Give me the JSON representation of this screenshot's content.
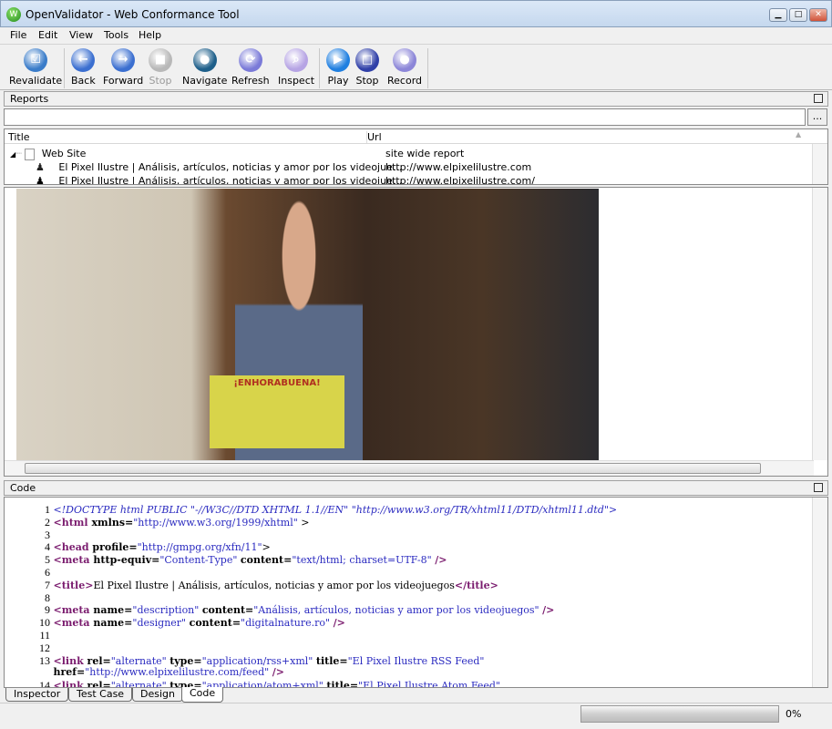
{
  "window": {
    "title": "OpenValidator - Web Conformance Tool",
    "icon": "app-logo-icon",
    "minimize": "minimize-icon",
    "maximize": "maximize-icon",
    "close": "close-icon"
  },
  "menu": [
    "File",
    "Edit",
    "View",
    "Tools",
    "Help"
  ],
  "toolbar": [
    {
      "label": "Revalidate",
      "icon": "check-icon",
      "glyph": "☑",
      "color": "#3a7cc9",
      "enabled": true
    },
    {
      "label": "Back",
      "icon": "back-arrow-icon",
      "glyph": "←",
      "color": "#3b6fd0",
      "enabled": true
    },
    {
      "label": "Forward",
      "icon": "forward-arrow-icon",
      "glyph": "→",
      "color": "#3b6fd0",
      "enabled": true
    },
    {
      "label": "Stop",
      "icon": "stop-icon",
      "glyph": "■",
      "color": "#b8b8b8",
      "enabled": false
    },
    {
      "label": "Navigate",
      "icon": "globe-icon",
      "glyph": "●",
      "color": "#1e5f8a",
      "enabled": true
    },
    {
      "label": "Refresh",
      "icon": "refresh-icon",
      "glyph": "⟳",
      "color": "#7a7ad8",
      "enabled": true
    },
    {
      "label": "Inspect",
      "icon": "magnifier-icon",
      "glyph": "⌕",
      "color": "#b6a4e4",
      "enabled": true
    },
    {
      "label": "Play",
      "icon": "play-icon",
      "glyph": "▶",
      "color": "#1f7fe0",
      "enabled": true
    },
    {
      "label": "Stop",
      "icon": "stop-square-icon",
      "glyph": "□",
      "color": "#3040a8",
      "enabled": true
    },
    {
      "label": "Record",
      "icon": "record-icon",
      "glyph": "●",
      "color": "#8c86d8",
      "enabled": true
    }
  ],
  "reports": {
    "header": "Reports",
    "filter_value": "",
    "browse_label": "...",
    "columns": [
      "Title",
      "Url"
    ],
    "rows": [
      {
        "title": "Web Site",
        "url": "site wide report",
        "icon": "page-icon"
      },
      {
        "title": "El Pixel Ilustre | Análisis, artículos, noticias y amor por los videojue...",
        "url": "http://www.elpixelilustre.com",
        "icon": "inspector-figure-icon"
      },
      {
        "title": "El Pixel Ilustre | Análisis, artículos, noticias y amor por los videojue...",
        "url": "http://www.elpixelilustre.com/",
        "icon": "inspector-figure-icon"
      }
    ]
  },
  "browser": {
    "image": "photo of a young man holding a yellow ¡ENHORABUENA! card in front of bookshelves",
    "card_text": "¡ENHORABUENA!"
  },
  "code": {
    "header": "Code",
    "lines": [
      {
        "n": "1",
        "tokens": [
          [
            "d",
            "<!DOCTYPE html PUBLIC \"-//W3C//DTD XHTML 1.1//EN\" \"http://www.w3.org/TR/xhtml11/DTD/xhtml11.dtd\">"
          ]
        ]
      },
      {
        "n": "2",
        "tokens": [
          [
            "t",
            "<html "
          ],
          [
            "a",
            "xmlns="
          ],
          [
            "v",
            "\"http://www.w3.org/1999/xhtml\""
          ],
          [
            "x",
            " >"
          ]
        ]
      },
      {
        "n": "3",
        "tokens": []
      },
      {
        "n": "4",
        "tokens": [
          [
            "t",
            "<head "
          ],
          [
            "a",
            "profile="
          ],
          [
            "v",
            "\"http://gmpg.org/xfn/11\""
          ],
          [
            "x",
            ">"
          ]
        ]
      },
      {
        "n": "5",
        "tokens": [
          [
            "t",
            "<meta "
          ],
          [
            "a",
            "http-equiv="
          ],
          [
            "v",
            "\"Content-Type\" "
          ],
          [
            "a",
            "content="
          ],
          [
            "v",
            "\"text/html; charset=UTF-8\" "
          ],
          [
            "t",
            "/>"
          ]
        ]
      },
      {
        "n": "6",
        "tokens": []
      },
      {
        "n": "7",
        "tokens": [
          [
            "t",
            "<title>"
          ],
          [
            "x",
            "El Pixel Ilustre | Análisis, artículos, noticias y amor por los videojuegos"
          ],
          [
            "t",
            "</title>"
          ]
        ]
      },
      {
        "n": "8",
        "tokens": []
      },
      {
        "n": "9",
        "tokens": [
          [
            "t",
            "<meta "
          ],
          [
            "a",
            "name="
          ],
          [
            "v",
            "\"description\" "
          ],
          [
            "a",
            "content="
          ],
          [
            "v",
            "\"Análisis, artículos, noticias y amor por los videojuegos\" "
          ],
          [
            "t",
            "/>"
          ]
        ]
      },
      {
        "n": "10",
        "tokens": [
          [
            "t",
            "<meta "
          ],
          [
            "a",
            "name="
          ],
          [
            "v",
            "\"designer\" "
          ],
          [
            "a",
            "content="
          ],
          [
            "v",
            "\"digitalnature.ro\" "
          ],
          [
            "t",
            "/>"
          ]
        ]
      },
      {
        "n": "11",
        "tokens": []
      },
      {
        "n": "12",
        "tokens": []
      },
      {
        "n": "13",
        "tokens": [
          [
            "t",
            "<link "
          ],
          [
            "a",
            "rel="
          ],
          [
            "v",
            "\"alternate\" "
          ],
          [
            "a",
            "type="
          ],
          [
            "v",
            "\"application/rss+xml\" "
          ],
          [
            "a",
            "title="
          ],
          [
            "v",
            "\"El Pixel Ilustre RSS Feed\""
          ]
        ]
      },
      {
        "n": "",
        "tokens": [
          [
            "a",
            "href="
          ],
          [
            "v",
            "\"http://www.elpixelilustre.com/feed\" "
          ],
          [
            "t",
            "/>"
          ]
        ]
      },
      {
        "n": "14",
        "tokens": [
          [
            "t",
            "<link "
          ],
          [
            "a",
            "rel="
          ],
          [
            "v",
            "\"alternate\" "
          ],
          [
            "a",
            "type="
          ],
          [
            "v",
            "\"application/atom+xml\" "
          ],
          [
            "a",
            "title="
          ],
          [
            "v",
            "\"El Pixel Ilustre Atom Feed\""
          ]
        ]
      }
    ]
  },
  "tabs": [
    {
      "label": "Inspector",
      "active": false
    },
    {
      "label": "Test Case",
      "active": false
    },
    {
      "label": "Design",
      "active": false
    },
    {
      "label": "Code",
      "active": true
    }
  ],
  "status": {
    "progress_percent": 0,
    "progress_label": "0%"
  }
}
